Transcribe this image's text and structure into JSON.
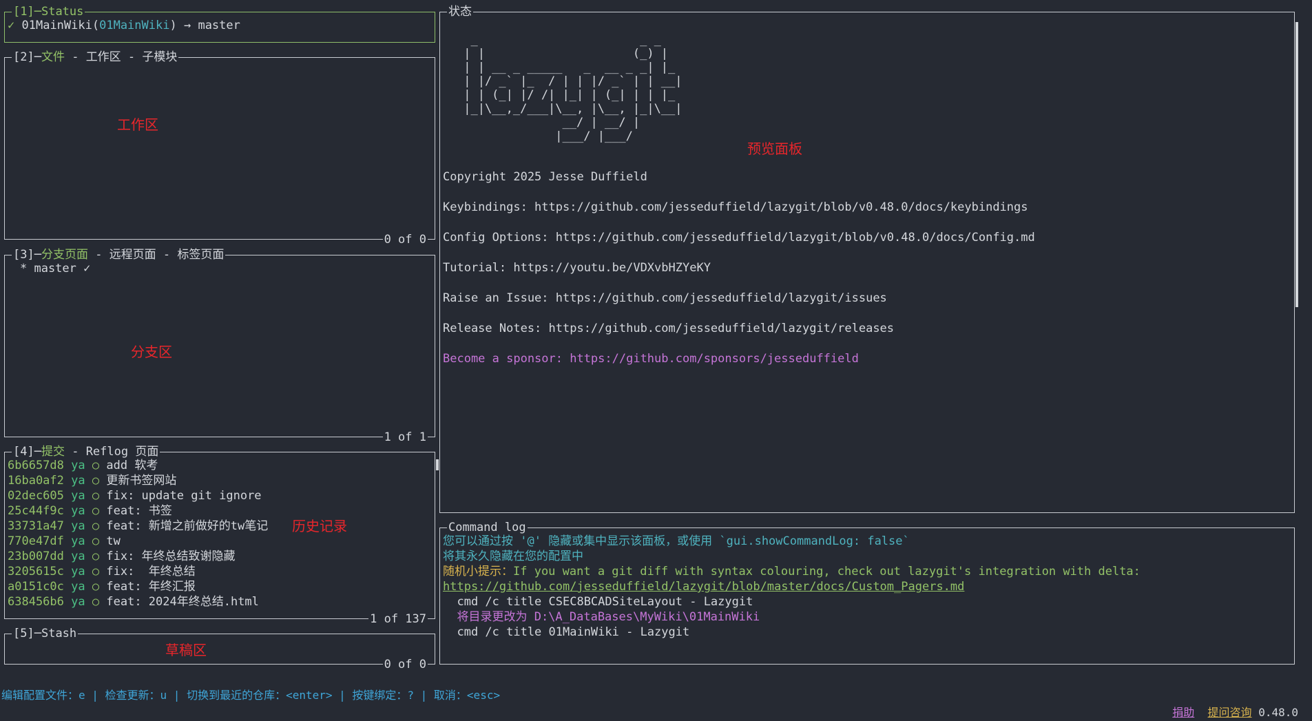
{
  "status": {
    "title_num": "[1]",
    "title": "Status",
    "check": "✓",
    "repo": "01MainWiki",
    "repo_paren": "01MainWiki",
    "arrow": "→",
    "branch": "master"
  },
  "files": {
    "title_num": "[2]",
    "tab_active": "文件",
    "tab2": "工作区",
    "tab3": "子模块",
    "footer": "0 of 0",
    "annotation": "工作区"
  },
  "branches": {
    "title_num": "[3]",
    "tab_active": "分支页面",
    "tab2": "远程页面",
    "tab3": "标签页面",
    "item": "* master ✓",
    "footer": "1 of 1",
    "annotation": "分支区"
  },
  "commits": {
    "title_num": "[4]",
    "tab_active": "提交",
    "tab2": "Reflog 页面",
    "footer": "1 of 137",
    "annotation": "历史记录",
    "rows": [
      {
        "hash": "6b6657d8",
        "author": "ya",
        "sym": "○",
        "msg": "add 软考"
      },
      {
        "hash": "16ba0af2",
        "author": "ya",
        "sym": "○",
        "msg": "更新书签网站"
      },
      {
        "hash": "02dec605",
        "author": "ya",
        "sym": "○",
        "msg": "fix: update git ignore"
      },
      {
        "hash": "25c44f9c",
        "author": "ya",
        "sym": "○",
        "msg": "feat: 书签"
      },
      {
        "hash": "33731a47",
        "author": "ya",
        "sym": "○",
        "msg": "feat: 新增之前做好的tw笔记"
      },
      {
        "hash": "770e47df",
        "author": "ya",
        "sym": "○",
        "msg": "tw"
      },
      {
        "hash": "23b007dd",
        "author": "ya",
        "sym": "○",
        "msg": "fix: 年终总结致谢隐藏"
      },
      {
        "hash": "3205615c",
        "author": "ya",
        "sym": "○",
        "msg": "fix:  年终总结"
      },
      {
        "hash": "a0151c0c",
        "author": "ya",
        "sym": "○",
        "msg": "feat: 年终汇报"
      },
      {
        "hash": "638456b6",
        "author": "ya",
        "sym": "○",
        "msg": "feat: 2024年终总结.html"
      }
    ]
  },
  "stash": {
    "title_num": "[5]",
    "title": "Stash",
    "footer": "0 of 0",
    "annotation": "草稿区"
  },
  "preview": {
    "title": "状态",
    "annotation": "预览面板",
    "ascii": "  _                       _ _\n | |                     (_) |\n | | __ _ _____   _  __ _ _| |_\n | |/ _` |_  / | | |/ _` | | __|\n | | (_| |/ /| |_| | (_| | | |_\n |_|\\__,_/___|\\__, |\\__, |_|\\__|\n               __/ | __/ |\n              |___/ |___/",
    "copyright": "Copyright 2025 Jesse Duffield",
    "keybindings": "Keybindings: https://github.com/jesseduffield/lazygit/blob/v0.48.0/docs/keybindings",
    "config": "Config Options: https://github.com/jesseduffield/lazygit/blob/v0.48.0/docs/Config.md",
    "tutorial": "Tutorial: https://youtu.be/VDXvbHZYeKY",
    "issue": "Raise an Issue: https://github.com/jesseduffield/lazygit/issues",
    "release": "Release Notes: https://github.com/jesseduffield/lazygit/releases",
    "sponsor": "Become a sponsor: https://github.com/sponsors/jesseduffield"
  },
  "cmdlog": {
    "title": "Command log",
    "line1": "您可以通过按 '@' 隐藏或集中显示该面板，或使用 `gui.showCommandLog: false`",
    "line2": "将其永久隐藏在您的配置中",
    "tip_label": "随机小提示：",
    "tip_text": "If you want a git diff with syntax colouring, check out lazygit's integration with delta:",
    "tip_link": "https://github.com/jesseduffield/lazygit/blob/master/docs/Custom_Pagers.md",
    "cmd1": "  cmd /c title CSEC8BCADSiteLayout - Lazygit",
    "cmd2": "  将目录更改为 D:\\A_DataBases\\MyWiki\\01MainWiki",
    "cmd3": "  cmd /c title 01MainWiki - Lazygit"
  },
  "bottom": {
    "hints": "编辑配置文件：e | 检查更新：u | 切换到最近的仓库：<enter> | 按键绑定：? | 取消：<esc>",
    "donate": "捐助",
    "ask": "提问咨询",
    "version": "0.48.0"
  },
  "colors": {
    "background": "#262a33",
    "active_border": "#8fbf6a",
    "annotation": "#e8262b",
    "hash": "#93c267",
    "author": "#4cc085",
    "sponsor": "#c675d8"
  }
}
